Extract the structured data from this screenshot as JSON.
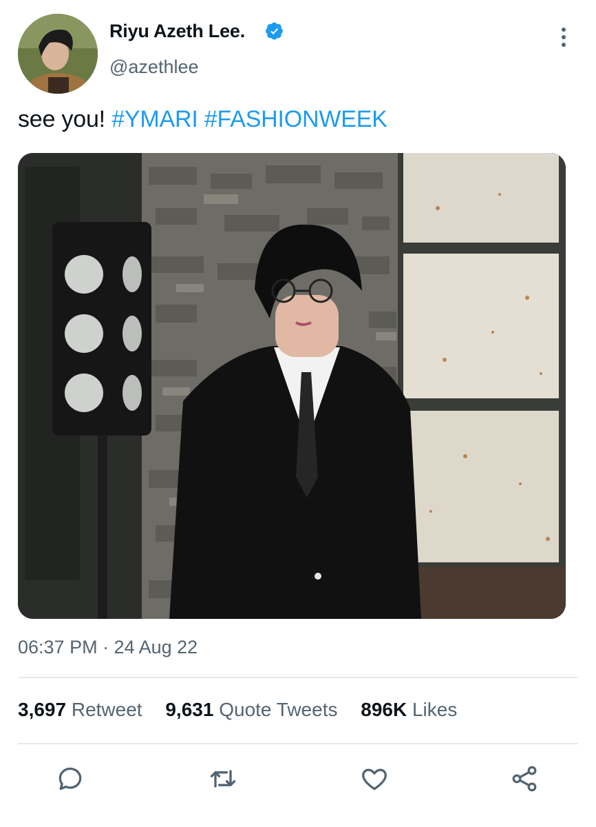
{
  "author": {
    "display_name": "Riyu Azeth Lee.",
    "handle": "@azethlee",
    "verified": true
  },
  "tweet": {
    "text_plain": "see you! ",
    "hashtags": [
      "#YMARI",
      "#FASHIONWEEK"
    ],
    "timestamp": "06:37 PM · 24 Aug 22"
  },
  "stats": {
    "retweets_count": "3,697",
    "retweets_label": "Retweet",
    "quotes_count": "9,631",
    "quotes_label": "Quote Tweets",
    "likes_count": "896K",
    "likes_label": "Likes"
  },
  "icons": {
    "more": "more-vertical-icon",
    "reply": "reply-icon",
    "retweet": "retweet-icon",
    "like": "heart-icon",
    "share": "share-icon",
    "verified": "verified-badge-icon"
  },
  "colors": {
    "accent": "#1d9bf0",
    "text": "#0f1419",
    "secondary": "#536471",
    "divider": "#e7e9ea"
  }
}
